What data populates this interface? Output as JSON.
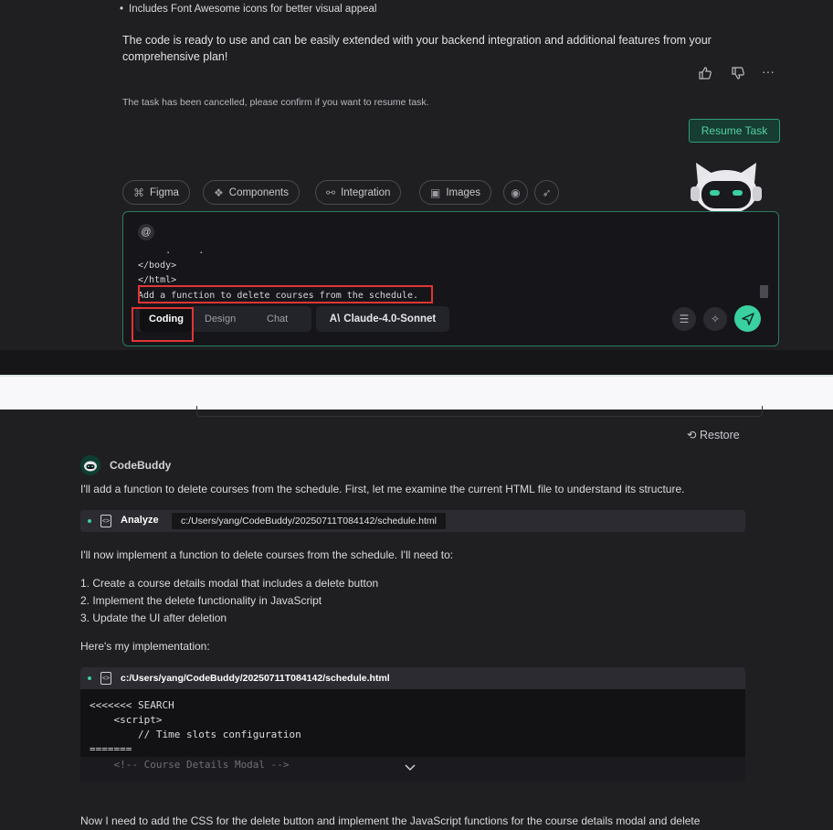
{
  "top": {
    "bullet_text": "Includes Font Awesome icons for better visual appeal",
    "paragraph": "The code is ready to use and can be easily extended with your backend integration and additional features from your comprehensive plan!",
    "feedback": {
      "like_icon": "thumbs-up-icon",
      "dislike_icon": "thumbs-down-icon",
      "more": "···"
    },
    "cancel_note": "The task has been cancelled, please confirm if you want to resume task.",
    "resume_button": "Resume Task",
    "chips": [
      {
        "label": "Figma",
        "icon": "figma-icon"
      },
      {
        "label": "Components",
        "icon": "components-icon"
      },
      {
        "label": "Integration",
        "icon": "integration-icon"
      },
      {
        "label": "Images",
        "icon": "images-icon"
      }
    ],
    "editor": {
      "at_symbol": "@",
      "code_lines": [
        "     .     .",
        "</body>",
        "</html>"
      ],
      "highlighted_line": "Add a function to delete courses from the schedule.",
      "modes": [
        "Coding",
        "Design",
        "Chat"
      ],
      "active_mode": "Coding",
      "model_prefix": "A\\",
      "model_name": "Claude-4.0-Sonnet"
    },
    "accent_color": "#3ad0a0",
    "highlight_color": "#e03535"
  },
  "bottom": {
    "restore_label": "Restore",
    "assistant_name": "CodeBuddy",
    "intro": "I'll add a function to delete courses from the schedule. First, let me examine the current HTML file to understand its structure.",
    "analyze_label": "Analyze",
    "analyze_path": "c:/Users/yang/CodeBuddy/20250711T084142/schedule.html",
    "plan_intro": "I'll now implement a function to delete courses from the schedule. I'll need to:",
    "steps": [
      "1. Create a course details modal that includes a delete button",
      "2. Implement the delete functionality in JavaScript",
      "3. Update the UI after deletion"
    ],
    "impl_intro": "Here's my implementation:",
    "code_path": "c:/Users/yang/CodeBuddy/20250711T084142/schedule.html",
    "code_lines": [
      "<<<<<<< SEARCH",
      "    <script>",
      "        // Time slots configuration",
      "======="
    ],
    "code_faded": "    <!-- Course Details Modal -->",
    "outro": "Now I need to add the CSS for the delete button and implement the JavaScript functions for the course details modal and delete"
  }
}
